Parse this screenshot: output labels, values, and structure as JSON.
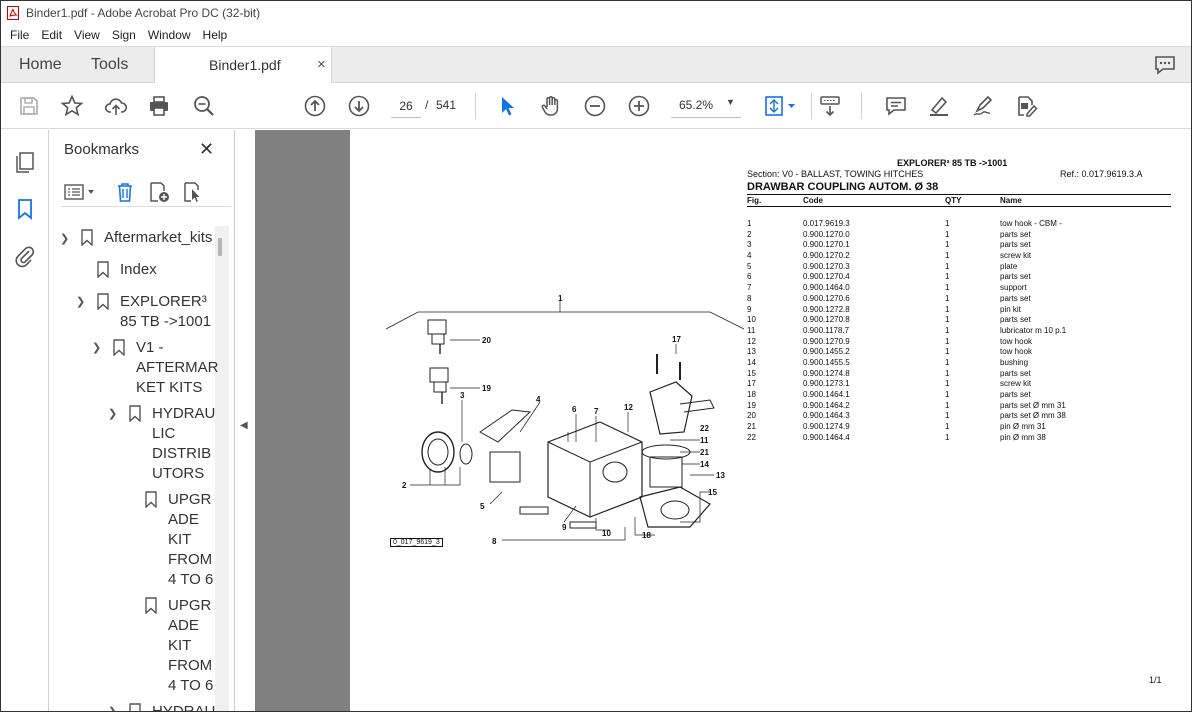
{
  "window": {
    "title": "Binder1.pdf - Adobe Acrobat Pro DC (32-bit)"
  },
  "menu": [
    "File",
    "Edit",
    "View",
    "Sign",
    "Window",
    "Help"
  ],
  "tabs": {
    "home": "Home",
    "tools": "Tools",
    "document": "Binder1.pdf",
    "close": "×"
  },
  "toolbar": {
    "page_current": "26",
    "page_sep": "/",
    "page_total": "541",
    "zoom": "65.2%",
    "accent_color": "#1473e6"
  },
  "bookmarks": {
    "title": "Bookmarks",
    "close": "✕",
    "items": [
      {
        "label": "Aftermarket_kits",
        "expanded": true
      },
      {
        "label": "Index"
      },
      {
        "label": "EXPLORER³ 85 TB ->1001",
        "lines": [
          "EXPLORER³",
          "85 TB ->1001"
        ],
        "expanded": true
      },
      {
        "label": "V1 - AFTERMARKET KITS",
        "lines": [
          "V1 -",
          "AFTERMAR",
          "KET KITS"
        ],
        "expanded": true
      },
      {
        "label": "HYDRAULIC DISTRIBUTORS",
        "lines": [
          "HYDRAU",
          "LIC",
          "DISTRIB",
          "UTORS"
        ],
        "expanded": true
      },
      {
        "label": "UPGRADE KIT FROM 4 TO 6",
        "lines": [
          "UPGR",
          "ADE",
          "KIT",
          "FROM",
          "4 TO 6"
        ]
      },
      {
        "label": "UPGRADE KIT FROM 4 TO 6",
        "lines": [
          "UPGR",
          "ADE",
          "KIT",
          "FROM",
          "4 TO 6"
        ]
      },
      {
        "label": "HYDRAU",
        "lines": [
          "HYDRAU"
        ]
      }
    ]
  },
  "pdf_page": {
    "header": "EXPLORER³ 85 TB ->1001",
    "section": "Section: V0 - BALLAST, TOWING HITCHES",
    "ref": "Ref.: 0.017.9619.3.A",
    "title": "DRAWBAR COUPLING AUTOM. Ø 38",
    "columns": {
      "fig": "Fig.",
      "code": "Code",
      "qty": "QTY",
      "name": "Name"
    },
    "parts": [
      {
        "fig": "1",
        "code": "0.017.9619.3",
        "qty": "1",
        "name": "tow hook - CBM -"
      },
      {
        "fig": "2",
        "code": "0.900.1270.0",
        "qty": "1",
        "name": "parts set"
      },
      {
        "fig": "3",
        "code": "0.900.1270.1",
        "qty": "1",
        "name": "parts set"
      },
      {
        "fig": "4",
        "code": "0.900.1270.2",
        "qty": "1",
        "name": "screw kit"
      },
      {
        "fig": "5",
        "code": "0.900.1270.3",
        "qty": "1",
        "name": "plate"
      },
      {
        "fig": "6",
        "code": "0.900.1270.4",
        "qty": "1",
        "name": "parts set"
      },
      {
        "fig": "7",
        "code": "0.900.1464.0",
        "qty": "1",
        "name": "support"
      },
      {
        "fig": "8",
        "code": "0.900.1270.6",
        "qty": "1",
        "name": "parts set"
      },
      {
        "fig": "9",
        "code": "0.900.1272.8",
        "qty": "1",
        "name": "pin kit"
      },
      {
        "fig": "10",
        "code": "0.900.1270.8",
        "qty": "1",
        "name": "parts set"
      },
      {
        "fig": "11",
        "code": "0.900.1178.7",
        "qty": "1",
        "name": "lubricator m 10 p.1"
      },
      {
        "fig": "12",
        "code": "0.900.1270.9",
        "qty": "1",
        "name": "tow hook"
      },
      {
        "fig": "13",
        "code": "0.900.1455.2",
        "qty": "1",
        "name": "tow hook"
      },
      {
        "fig": "14",
        "code": "0.900.1455.5",
        "qty": "1",
        "name": "bushing"
      },
      {
        "fig": "15",
        "code": "0.900.1274.8",
        "qty": "1",
        "name": "parts set"
      },
      {
        "fig": "17",
        "code": "0.900.1273.1",
        "qty": "1",
        "name": "screw kit"
      },
      {
        "fig": "18",
        "code": "0.900.1464.1",
        "qty": "1",
        "name": "parts set"
      },
      {
        "fig": "19",
        "code": "0.900.1464.2",
        "qty": "1",
        "name": "parts set Ø mm 31"
      },
      {
        "fig": "20",
        "code": "0.900.1464.3",
        "qty": "1",
        "name": "parts set Ø mm 38"
      },
      {
        "fig": "21",
        "code": "0.900.1274.9",
        "qty": "1",
        "name": "pin Ø mm 31"
      },
      {
        "fig": "22",
        "code": "0.900.1464.4",
        "qty": "1",
        "name": "pin Ø mm 38"
      }
    ],
    "diagram_ref": "0_017_9619_3",
    "diagram_labels": [
      "1",
      "2",
      "3",
      "4",
      "5",
      "6",
      "7",
      "8",
      "9",
      "10",
      "11",
      "12",
      "13",
      "14",
      "15",
      "17",
      "18",
      "19",
      "20",
      "21",
      "22"
    ],
    "footer": "1/1"
  }
}
